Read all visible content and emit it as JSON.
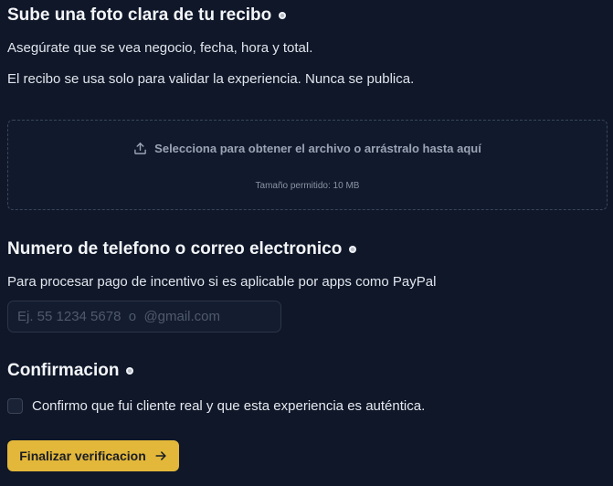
{
  "receipt": {
    "title": "Sube una foto clara de tu recibo",
    "desc1": "Asegúrate que se vea negocio, fecha, hora y total.",
    "desc2": "El recibo se usa solo para validar la experiencia. Nunca se publica.",
    "dropzone_text": "Selecciona para obtener el archivo o arrástralo hasta aquí",
    "dropzone_hint": "Tamaño permitido: 10 MB",
    "required_icon": "required-asterisk-icon",
    "upload_icon": "upload-icon"
  },
  "contact": {
    "title": "Numero de telefono o correo electronico",
    "desc": "Para procesar pago de incentivo si es aplicable por apps como PayPal",
    "placeholder": "Ej. 55 1234 5678  o  @gmail.com",
    "value": ""
  },
  "confirmation": {
    "title": "Confirmacion",
    "checkbox_label": "Confirmo que fui cliente real y que esta experiencia es auténtica.",
    "checked": false
  },
  "submit": {
    "label": "Finalizar verificacion",
    "icon": "arrow-right-icon"
  },
  "colors": {
    "background": "#0f1729",
    "accent_button": "#e2b73a",
    "text": "#e6e9ef"
  }
}
